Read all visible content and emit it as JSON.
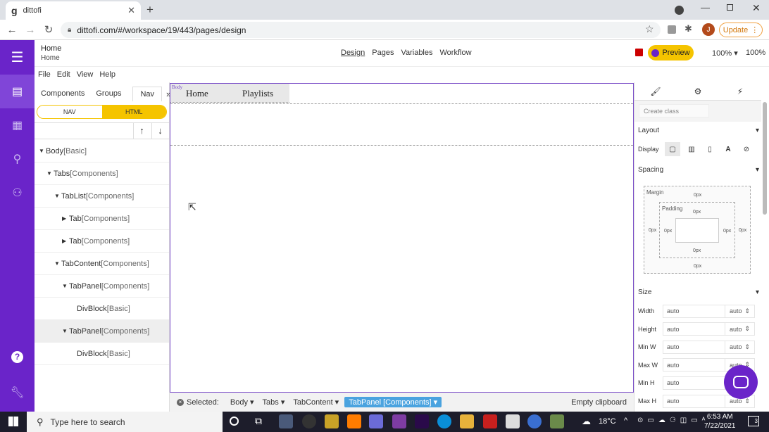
{
  "browser": {
    "tab_title": "dittofi",
    "tab_favicon": "g",
    "url": "dittofi.com/#/workspace/19/443/pages/design",
    "update_label": "Update",
    "avatar_initial": "J"
  },
  "topbar": {
    "page_title": "Home",
    "page_subtitle": "Home",
    "nav": [
      "Design",
      "Pages",
      "Variables",
      "Workflow"
    ],
    "preview_label": "Preview",
    "zoom_select": "100%",
    "zoom_value": "100%"
  },
  "menu": [
    "File",
    "Edit",
    "View",
    "Help"
  ],
  "left_panel": {
    "tabs": [
      "Components",
      "Groups",
      "Nav"
    ],
    "more": "»",
    "toggle": {
      "left": "NAV",
      "right": "HTML",
      "active": "right"
    },
    "tree": [
      {
        "label": "Body",
        "type": "[Basic]",
        "depth": 0,
        "caret": "down"
      },
      {
        "label": "Tabs",
        "type": "[Components]",
        "depth": 1,
        "caret": "down"
      },
      {
        "label": "TabList",
        "type": "[Components]",
        "depth": 2,
        "caret": "down"
      },
      {
        "label": "Tab",
        "type": "[Components]",
        "depth": 3,
        "caret": "right"
      },
      {
        "label": "Tab",
        "type": "[Components]",
        "depth": 3,
        "caret": "right"
      },
      {
        "label": "TabContent",
        "type": "[Components]",
        "depth": 2,
        "caret": "down"
      },
      {
        "label": "TabPanel",
        "type": "[Components]",
        "depth": 3,
        "caret": "down"
      },
      {
        "label": "DivBlock",
        "type": "[Basic]",
        "depth": 4,
        "caret": ""
      },
      {
        "label": "TabPanel",
        "type": "[Components]",
        "depth": 3,
        "caret": "down",
        "selected": true
      },
      {
        "label": "DivBlock",
        "type": "[Basic]",
        "depth": 4,
        "caret": ""
      }
    ]
  },
  "canvas": {
    "body_label": "Body",
    "tabs": [
      "Home",
      "Playlists"
    ]
  },
  "status": {
    "selected_label": "Selected:",
    "crumbs": [
      "Body",
      "Tabs",
      "TabContent"
    ],
    "selected_crumb": "TabPanel [Components]",
    "clipboard": "Empty clipboard"
  },
  "right_panel": {
    "create_class_placeholder": "Create class",
    "layout_label": "Layout",
    "display_label": "Display",
    "spacing_label": "Spacing",
    "margin_label": "Margin",
    "padding_label": "Padding",
    "zero": "0px",
    "size_label": "Size",
    "size_rows": [
      {
        "label": "Width",
        "value": "auto",
        "unit": "auto"
      },
      {
        "label": "Height",
        "value": "auto",
        "unit": "auto"
      },
      {
        "label": "Min W",
        "value": "auto",
        "unit": "auto"
      },
      {
        "label": "Max W",
        "value": "auto",
        "unit": "auto"
      },
      {
        "label": "Min H",
        "value": "auto",
        "unit": "auto"
      },
      {
        "label": "Max H",
        "value": "auto",
        "unit": "auto"
      }
    ]
  },
  "taskbar": {
    "search_placeholder": "Type here to search",
    "weather": "18°C",
    "time": "6:53 AM",
    "date": "7/22/2021",
    "notifications": "3"
  },
  "colors": {
    "brand": "#6a24c9",
    "accent": "#f5c400",
    "selection": "#4aa3df"
  }
}
